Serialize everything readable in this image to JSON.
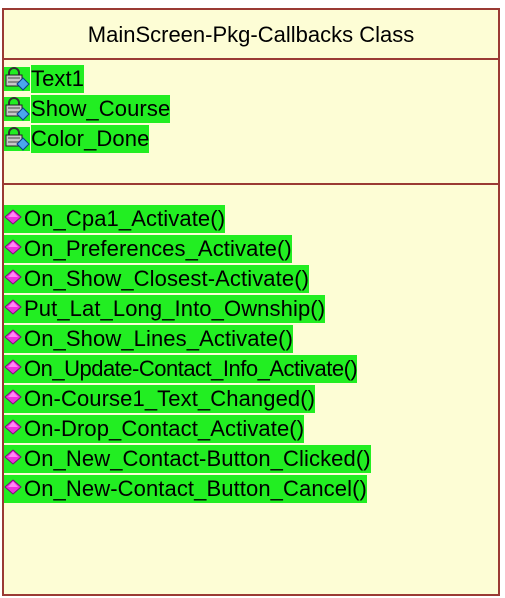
{
  "class": {
    "title": "MainScreen-Pkg-Callbacks Class",
    "colors": {
      "fill": "#fdfdd5",
      "border": "#9a3a34",
      "highlight": "#22ee22",
      "attribute_icon": "lock-diamond-icon",
      "method_icon": "magenta-diamond-icon"
    },
    "attributes": [
      {
        "name": "Text1"
      },
      {
        "name": "Show_Course"
      },
      {
        "name": "Color_Done"
      }
    ],
    "methods": [
      {
        "name": "On_Cpa1_Activate()"
      },
      {
        "name": "On_Preferences_Activate()"
      },
      {
        "name": "On_Show_Closest-Activate()"
      },
      {
        "name": "Put_Lat_Long_Into_Ownship()"
      },
      {
        "name": "On_Show_Lines_Activate()"
      },
      {
        "name": "On_Update-Contact_Info_Activate()"
      },
      {
        "name": "On-Course1_Text_Changed()"
      },
      {
        "name": "On-Drop_Contact_Activate()"
      },
      {
        "name": "On_New_Contact-Button_Clicked()"
      },
      {
        "name": "On_New-Contact_Button_Cancel()"
      }
    ]
  }
}
